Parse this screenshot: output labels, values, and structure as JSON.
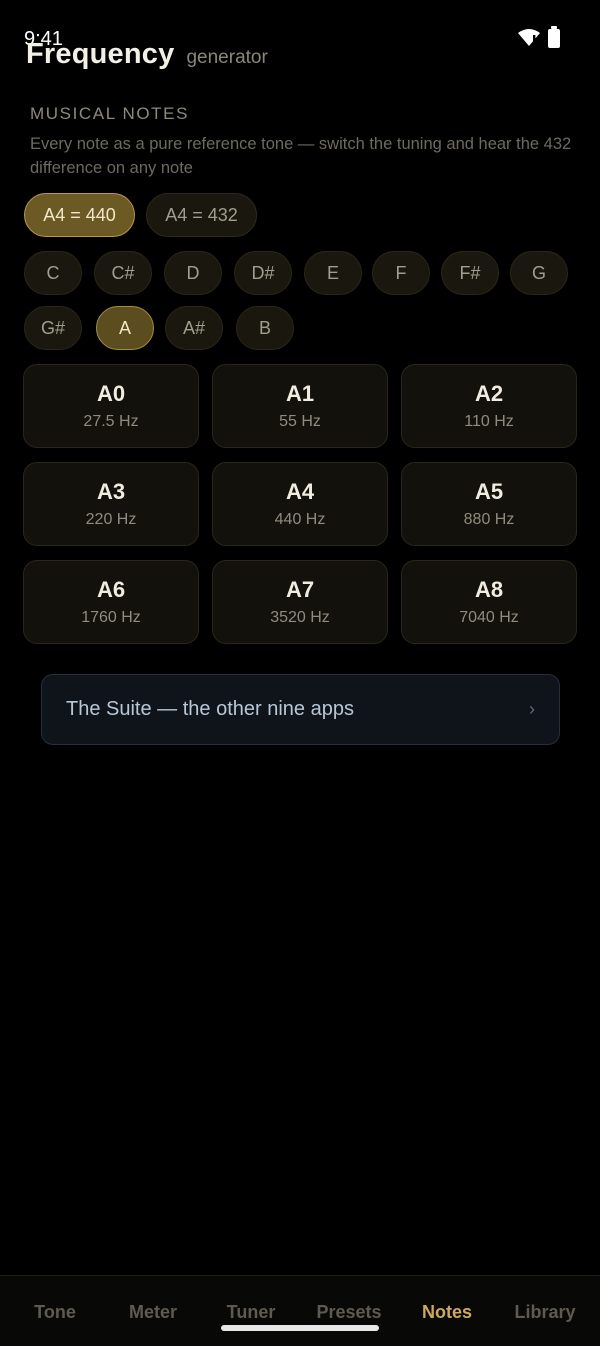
{
  "status": {
    "time": "9:41"
  },
  "header": {
    "title": "Frequency",
    "subtitle": "generator"
  },
  "section": {
    "label": "MUSICAL NOTES",
    "description": "Every note as a pure reference tone — switch the tuning and hear the 432 difference on any note"
  },
  "tuning": {
    "options": [
      "A4 = 440",
      "A4 = 432"
    ],
    "selected": "A4 = 440"
  },
  "notes": {
    "items": [
      "C",
      "C#",
      "D",
      "D#",
      "E",
      "F",
      "F#",
      "G",
      "G#",
      "A",
      "A#",
      "B"
    ],
    "selected": "A"
  },
  "octaves": [
    {
      "name": "A0",
      "freq": "27.5 Hz"
    },
    {
      "name": "A1",
      "freq": "55 Hz"
    },
    {
      "name": "A2",
      "freq": "110 Hz"
    },
    {
      "name": "A3",
      "freq": "220 Hz"
    },
    {
      "name": "A4",
      "freq": "440 Hz"
    },
    {
      "name": "A5",
      "freq": "880 Hz"
    },
    {
      "name": "A6",
      "freq": "1760 Hz"
    },
    {
      "name": "A7",
      "freq": "3520 Hz"
    },
    {
      "name": "A8",
      "freq": "7040 Hz"
    }
  ],
  "suite_link": {
    "label": "The Suite — the other nine apps",
    "chevron": "›"
  },
  "nav": {
    "items": [
      "Tone",
      "Meter",
      "Tuner",
      "Presets",
      "Notes",
      "Library"
    ],
    "active": "Notes"
  },
  "colors": {
    "accent": "#d0a85a",
    "background": "#000000"
  }
}
